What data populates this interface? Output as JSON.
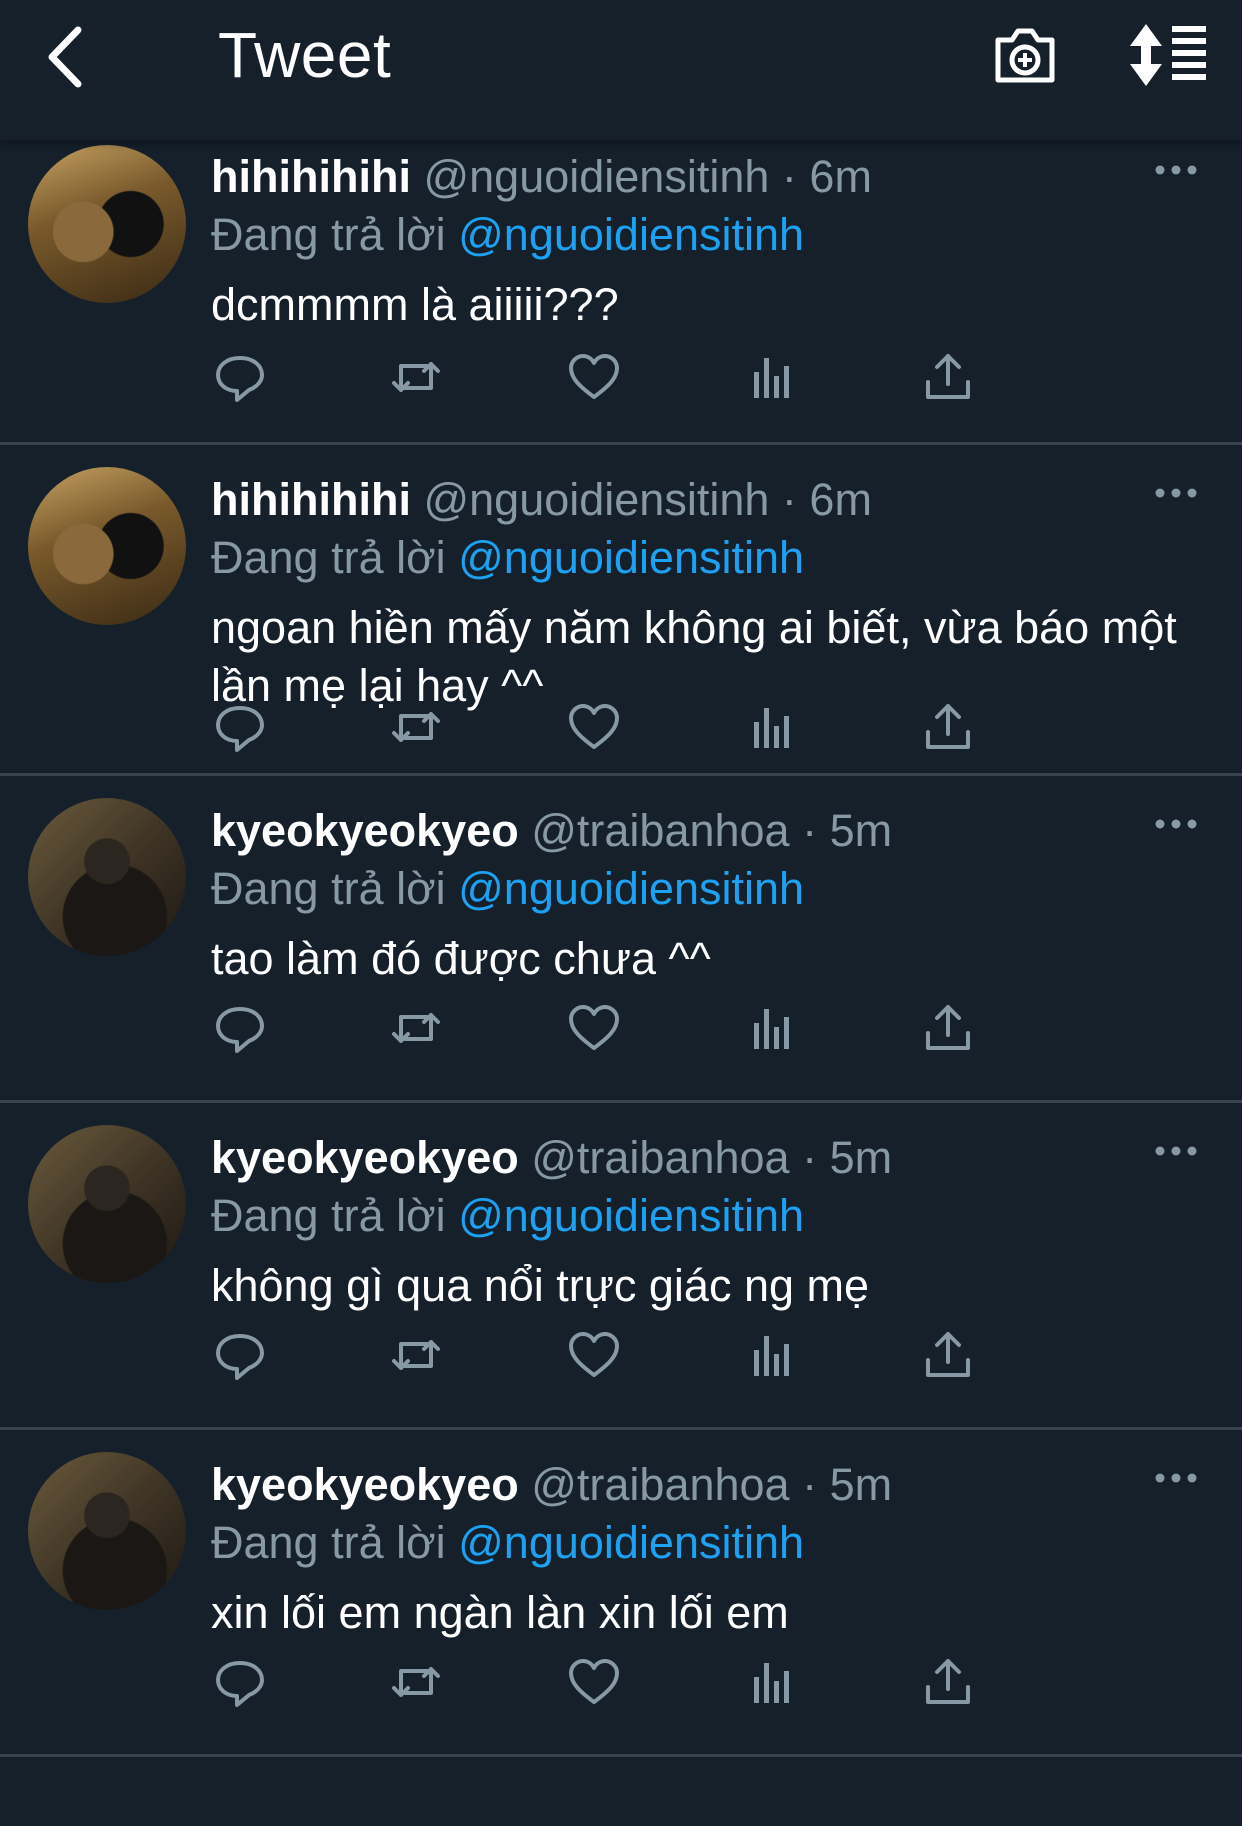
{
  "header": {
    "title": "Tweet",
    "back_icon": "chevron-left-icon",
    "camera_icon": "camera-plus-icon",
    "sort_icon": "sort-list-icon"
  },
  "colors": {
    "background": "#15202b",
    "text": "#ffffff",
    "muted": "#8899a6",
    "accent": "#1da1f2",
    "divider": "#38444d"
  },
  "tweets": [
    {
      "name": "hihihihihi",
      "handle": "@nguoidiensitinh",
      "time": "6m",
      "reply_prefix": "Đang trả lời",
      "reply_to": "@nguoidiensitinh",
      "text": "dcmmmm là aiiiii???"
    },
    {
      "name": "hihihihihi",
      "handle": "@nguoidiensitinh",
      "time": "6m",
      "reply_prefix": "Đang trả lời",
      "reply_to": "@nguoidiensitinh",
      "text": "ngoan hiền mấy năm không ai biết, vừa báo một lần mẹ lại hay ^^"
    },
    {
      "name": "kyeokyeokyeo",
      "handle": "@traibanhoa",
      "time": "5m",
      "reply_prefix": "Đang trả lời",
      "reply_to": "@nguoidiensitinh",
      "text": "tao làm đó được chưa ^^"
    },
    {
      "name": "kyeokyeokyeo",
      "handle": "@traibanhoa",
      "time": "5m",
      "reply_prefix": "Đang trả lời",
      "reply_to": "@nguoidiensitinh",
      "text": "không gì qua nổi trực giác ng mẹ"
    },
    {
      "name": "kyeokyeokyeo",
      "handle": "@traibanhoa",
      "time": "5m",
      "reply_prefix": "Đang trả lời",
      "reply_to": "@nguoidiensitinh",
      "text": "xin lối em ngàn làn xin lối em"
    }
  ],
  "action_icons": [
    "reply-icon",
    "retweet-icon",
    "like-icon",
    "analytics-icon",
    "share-icon"
  ],
  "separator": "·"
}
